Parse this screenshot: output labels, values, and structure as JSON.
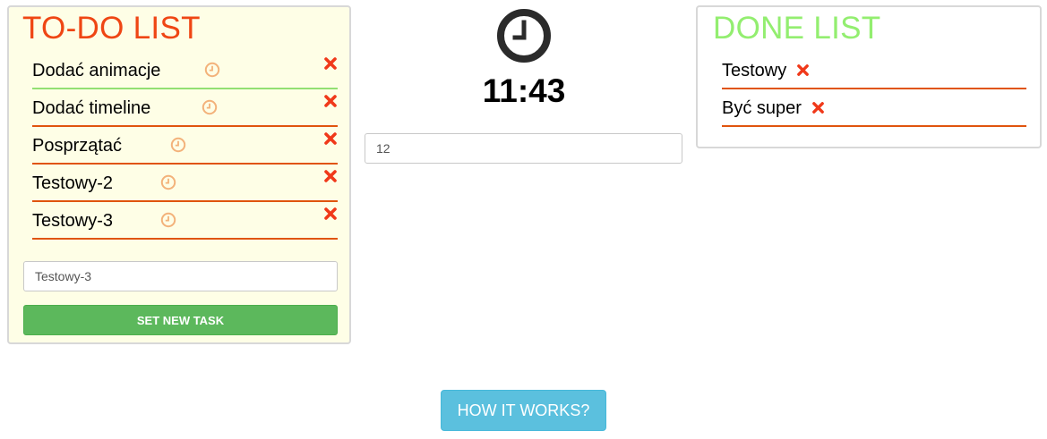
{
  "todo": {
    "title": "TO-DO LIST",
    "items": [
      {
        "label": "Dodać animacje"
      },
      {
        "label": "Dodać timeline"
      },
      {
        "label": "Posprzątać"
      },
      {
        "label": "Testowy-2"
      },
      {
        "label": "Testowy-3"
      }
    ],
    "input_value": "Testowy-3",
    "set_button_label": "SET NEW TASK"
  },
  "timer": {
    "time": "11:43",
    "minutes_value": "12"
  },
  "done": {
    "title": "DONE LIST",
    "items": [
      {
        "label": "Testowy"
      },
      {
        "label": "Być super"
      }
    ]
  },
  "help": {
    "button_label": "HOW IT WORKS?"
  },
  "colors": {
    "todo_title": "#ef4614",
    "done_title": "#93ee70",
    "item_underline": "#e0540e",
    "active_underline": "#92e072",
    "remove_icon": "#f0391a",
    "small_clock": "#f3b27a",
    "set_button": "#5cb85c",
    "help_button": "#5bc0de",
    "todo_panel_bg": "#fefee6"
  },
  "icons": {
    "task_clock": "clock-icon",
    "task_remove": "close-icon",
    "timer": "clock-icon"
  }
}
